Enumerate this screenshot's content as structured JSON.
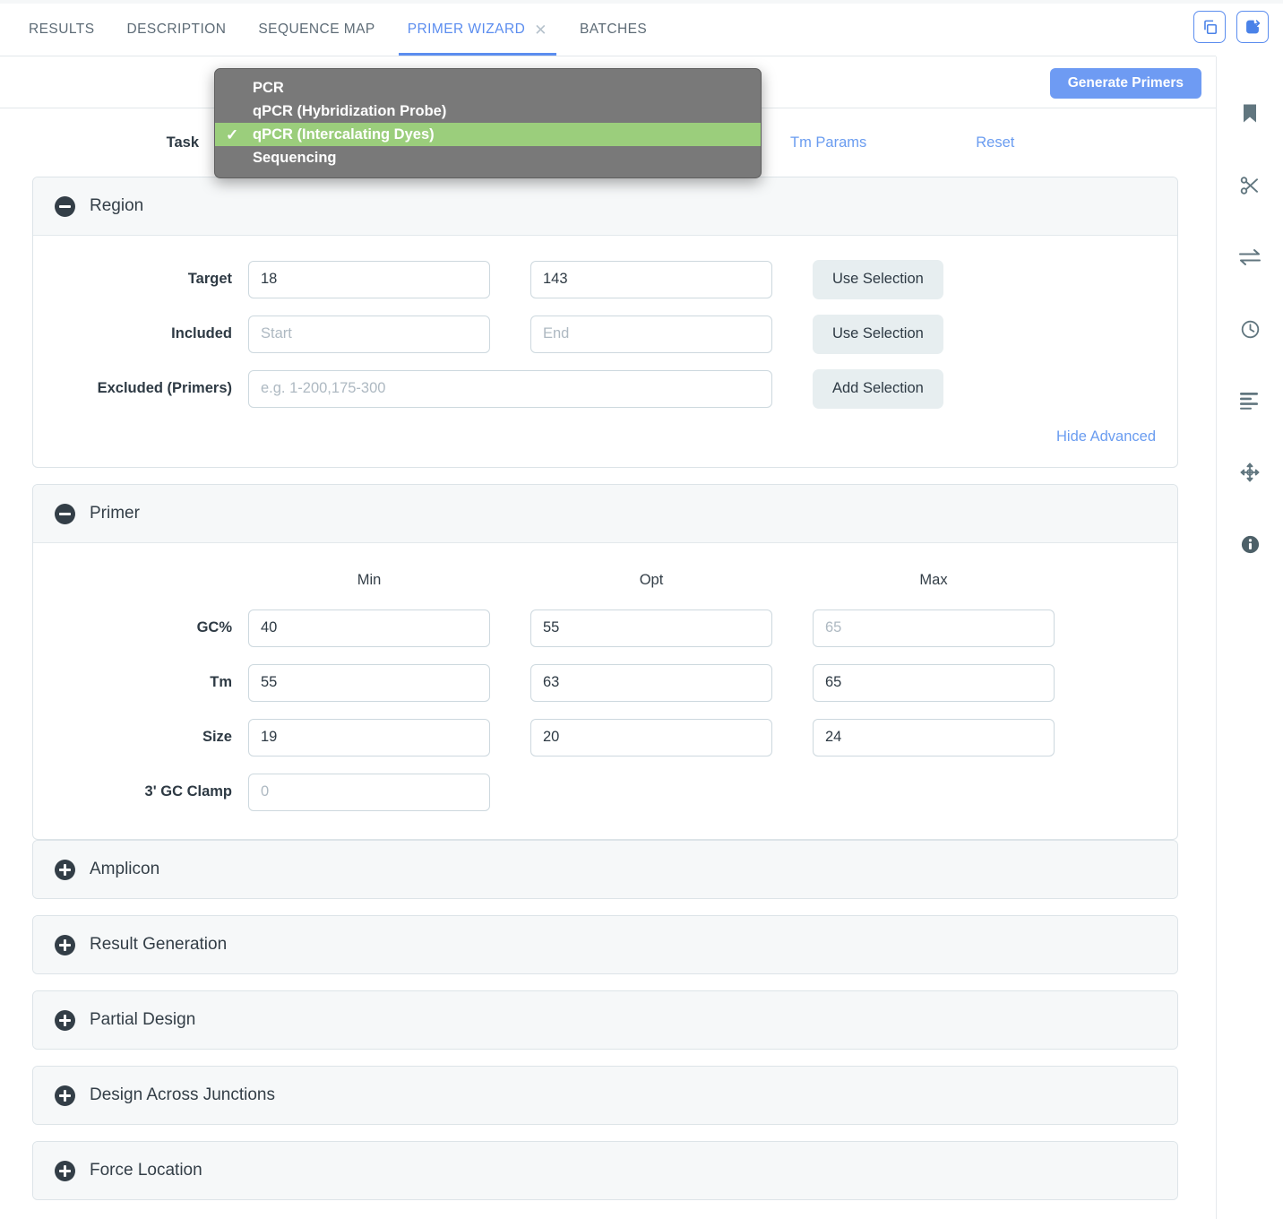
{
  "tabs": [
    {
      "label": "RESULTS",
      "active": false,
      "closable": false
    },
    {
      "label": "DESCRIPTION",
      "active": false,
      "closable": false
    },
    {
      "label": "SEQUENCE MAP",
      "active": false,
      "closable": false
    },
    {
      "label": "PRIMER WIZARD",
      "active": true,
      "closable": true,
      "close_glyph": "✕"
    },
    {
      "label": "BATCHES",
      "active": false,
      "closable": false
    }
  ],
  "topright": {
    "duplicate_icon": "duplicate-icon",
    "export_icon": "export-icon"
  },
  "actionbar": {
    "generate_label": "Generate Primers"
  },
  "task": {
    "label": "Task",
    "selected_value": "qPCR (Intercalating Dyes)",
    "tm_params_label": "Tm Params",
    "reset_label": "Reset"
  },
  "dropdown": {
    "check_glyph": "✓",
    "options": [
      {
        "label": "PCR",
        "selected": false
      },
      {
        "label": "qPCR (Hybridization Probe)",
        "selected": false
      },
      {
        "label": "qPCR (Intercalating Dyes)",
        "selected": true
      },
      {
        "label": "Sequencing",
        "selected": false
      }
    ]
  },
  "region": {
    "title": "Region",
    "rows": [
      {
        "label": "Target",
        "start_value": "18",
        "start_placeholder": "",
        "end_value": "143",
        "end_placeholder": "",
        "button": "Use Selection"
      },
      {
        "label": "Included",
        "start_value": "",
        "start_placeholder": "Start",
        "end_value": "",
        "end_placeholder": "End",
        "button": "Use Selection"
      }
    ],
    "excluded": {
      "label": "Excluded (Primers)",
      "value": "",
      "placeholder": "e.g. 1-200,175-300",
      "button": "Add Selection"
    },
    "advanced_link": "Hide Advanced"
  },
  "primer": {
    "title": "Primer",
    "columns": [
      "Min",
      "Opt",
      "Max"
    ],
    "rows": [
      {
        "label": "GC%",
        "min": {
          "value": "40",
          "placeholder": ""
        },
        "opt": {
          "value": "55",
          "placeholder": ""
        },
        "max": {
          "value": "",
          "placeholder": "65"
        }
      },
      {
        "label": "Tm",
        "min": {
          "value": "55",
          "placeholder": ""
        },
        "opt": {
          "value": "63",
          "placeholder": ""
        },
        "max": {
          "value": "65",
          "placeholder": ""
        }
      },
      {
        "label": "Size",
        "min": {
          "value": "19",
          "placeholder": ""
        },
        "opt": {
          "value": "20",
          "placeholder": ""
        },
        "max": {
          "value": "24",
          "placeholder": ""
        }
      }
    ],
    "clamp": {
      "label": "3' GC Clamp",
      "value": "",
      "placeholder": "0"
    }
  },
  "collapsed_sections": [
    {
      "title": "Amplicon"
    },
    {
      "title": "Result Generation"
    },
    {
      "title": "Partial Design"
    },
    {
      "title": "Design Across Junctions"
    },
    {
      "title": "Force Location"
    }
  ],
  "rail": [
    {
      "icon": "bookmark-icon"
    },
    {
      "icon": "scissors-icon"
    },
    {
      "icon": "swap-arrows-icon"
    },
    {
      "icon": "clock-icon"
    },
    {
      "icon": "align-left-icon"
    },
    {
      "icon": "move-crosshair-icon"
    },
    {
      "icon": "info-icon"
    }
  ],
  "colors": {
    "accent": "#5b8def",
    "button_blue": "#6e9bf3",
    "dropdown_bg": "#797979",
    "dropdown_selected": "#9bce7c",
    "panel_head": "#f6f8f9"
  }
}
